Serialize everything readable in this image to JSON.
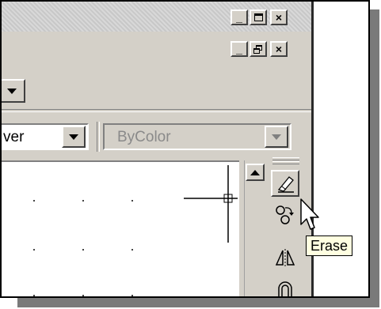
{
  "window": {
    "title_controls": {
      "minimize_symbol": "_",
      "maximize_symbol": "□",
      "close_symbol": "×"
    },
    "document_controls": {
      "minimize_symbol": "_",
      "restore_symbol": "🗗",
      "close_symbol": "×"
    }
  },
  "properties_toolbar": {
    "layer_combo_value": "ver",
    "color_combo_value": "ByColor"
  },
  "modify_toolbar": {
    "tools": [
      {
        "name": "erase",
        "icon": "eraser-icon"
      },
      {
        "name": "copy",
        "icon": "copy-object-icon"
      },
      {
        "name": "mirror",
        "icon": "mirror-icon"
      },
      {
        "name": "offset",
        "icon": "offset-icon"
      }
    ]
  },
  "tooltip": {
    "text": "Erase"
  },
  "colors": {
    "face": "#d4d0c8",
    "tooltip_bg": "#ffffe1",
    "drawing_bg": "#ffffff"
  }
}
